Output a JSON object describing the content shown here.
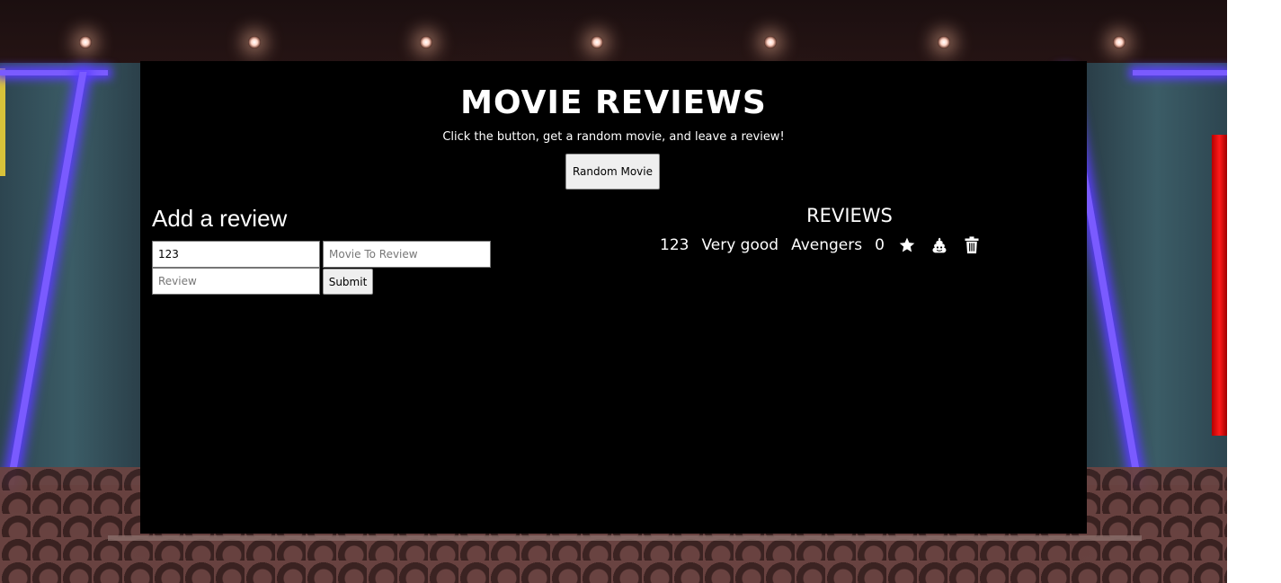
{
  "header": {
    "title": "MOVIE REVIEWS",
    "subtitle": "Click the button, get a random movie, and leave a review!",
    "random_button_label": "Random Movie"
  },
  "add_review": {
    "heading": "Add a review",
    "id_value": "123",
    "movie_placeholder": "Movie To Review",
    "movie_value": "",
    "review_placeholder": "Review",
    "review_value": "",
    "submit_label": "Submit"
  },
  "reviews": {
    "heading": "REVIEWS",
    "items": [
      {
        "id": "123",
        "text": "Very good",
        "movie": "Avengers",
        "votes": "0",
        "icons": [
          "star-icon",
          "poop-icon",
          "trash-icon"
        ]
      }
    ]
  }
}
